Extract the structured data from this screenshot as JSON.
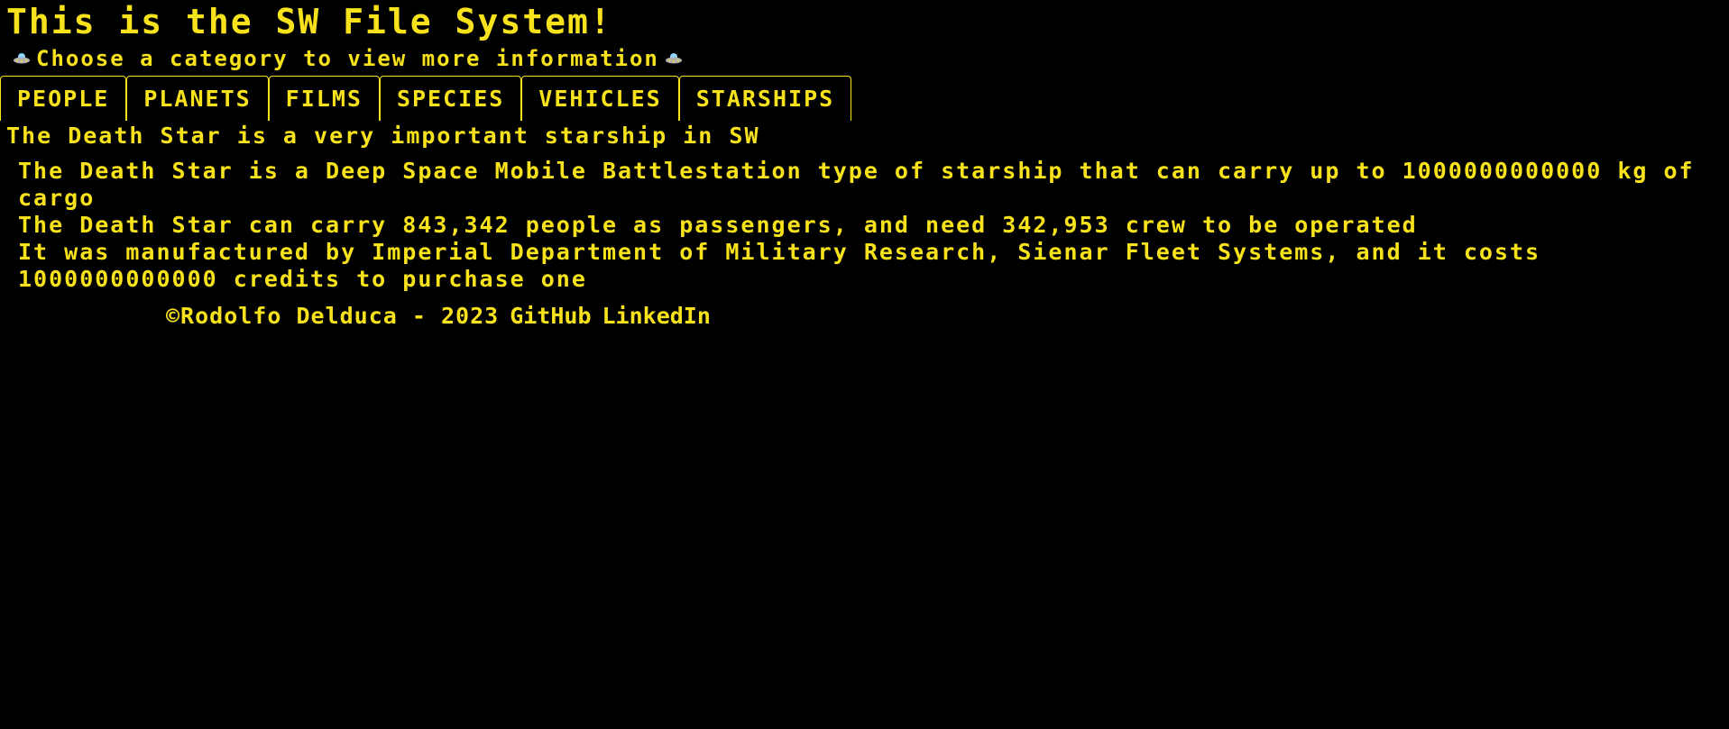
{
  "header": {
    "title": "This is the SW File System!",
    "subtitle": "Choose a category to view more information",
    "subtitle_icon": "ufo-icon"
  },
  "tabs": [
    {
      "label": "PEOPLE"
    },
    {
      "label": "PLANETS"
    },
    {
      "label": "FILMS"
    },
    {
      "label": "SPECIES"
    },
    {
      "label": "VEHICLES"
    },
    {
      "label": "STARSHIPS"
    }
  ],
  "main": {
    "heading": "The Death Star is a very important starship in SW",
    "lines": [
      "The Death Star is a Deep Space Mobile Battlestation type of starship that can carry up to 1000000000000 kg of cargo",
      "The Death Star can carry 843,342 people as passengers, and need 342,953 crew to be operated",
      "It was manufactured by Imperial Department of Military Research, Sienar Fleet Systems, and it costs 1000000000000 credits to purchase one"
    ]
  },
  "footer": {
    "copyright": "©Rodolfo Delduca - 2023",
    "github_label": "GitHub",
    "linkedin_label": "LinkedIn"
  },
  "colors": {
    "background": "#000000",
    "accent": "#f7e21b"
  }
}
